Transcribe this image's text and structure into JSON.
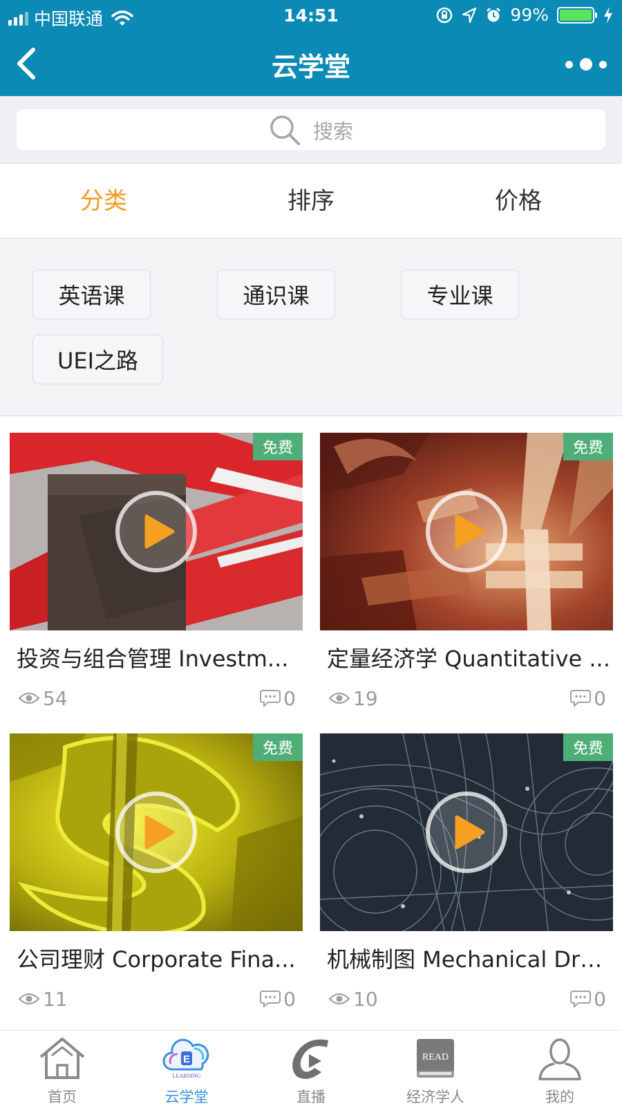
{
  "status_bar": {
    "carrier": "中国联通",
    "time": "14:51",
    "battery": "99%"
  },
  "nav": {
    "title": "云学堂",
    "back_icon": "chevron-left-icon",
    "more_icon": "more-dots-icon"
  },
  "search": {
    "placeholder": "搜索"
  },
  "filter_tabs": [
    {
      "label": "分类",
      "active": true
    },
    {
      "label": "排序",
      "active": false
    },
    {
      "label": "价格",
      "active": false
    }
  ],
  "categories": [
    "英语课",
    "通识课",
    "专业课",
    "UEI之路"
  ],
  "courses": [
    {
      "title": "投资与组合管理 Investm...",
      "badge": "免费",
      "views": "54",
      "comments": "0"
    },
    {
      "title": "定量经济学 Quantitative ...",
      "badge": "免费",
      "views": "19",
      "comments": "0"
    },
    {
      "title": "公司理财 Corporate Fina...",
      "badge": "免费",
      "views": "11",
      "comments": "0"
    },
    {
      "title": "机械制图 Mechanical Dra...",
      "badge": "免费",
      "views": "10",
      "comments": "0"
    }
  ],
  "tabbar": [
    {
      "label": "首页",
      "icon": "home-icon",
      "active": false
    },
    {
      "label": "云学堂",
      "icon": "cloud-learning-icon",
      "active": true,
      "icon_text": "E",
      "icon_subtext": "LEARNING"
    },
    {
      "label": "直播",
      "icon": "live-play-icon",
      "active": false
    },
    {
      "label": "经济学人",
      "icon": "read-book-icon",
      "active": false,
      "icon_text": "READ"
    },
    {
      "label": "我的",
      "icon": "user-icon",
      "active": false
    }
  ],
  "colors": {
    "brand": "#0b8ab5",
    "active_tab": "#f39a1e",
    "free_badge": "#4fae77",
    "tabbar_active": "#3a8fe0"
  }
}
